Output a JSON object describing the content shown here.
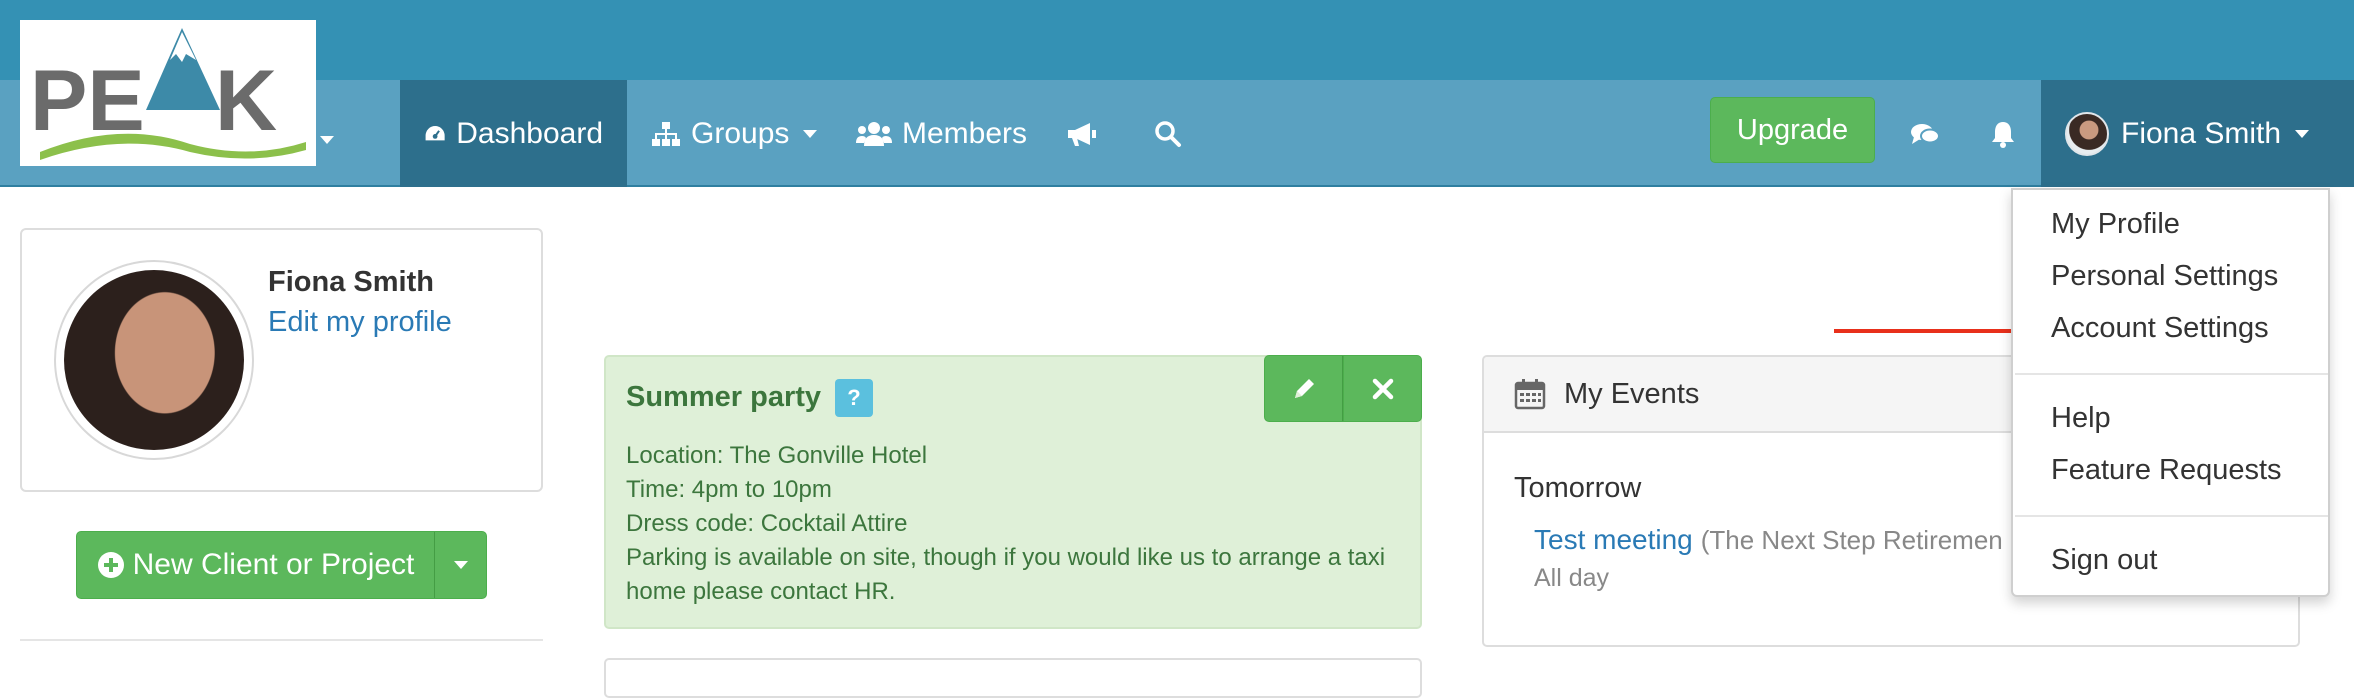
{
  "brand": {
    "logo_text": "PEAK"
  },
  "nav": {
    "dashboard": "Dashboard",
    "groups": "Groups",
    "members": "Members",
    "upgrade": "Upgrade",
    "user_name": "Fiona Smith"
  },
  "user_dropdown": {
    "items": [
      "My Profile",
      "Personal Settings",
      "Account Settings",
      "Help",
      "Feature Requests",
      "Sign out"
    ],
    "highlighted": "Account Settings"
  },
  "profile": {
    "name": "Fiona Smith",
    "edit_link": "Edit my profile"
  },
  "new_client_button": "New Client or Project",
  "announcement": {
    "title": "Summer party",
    "help_badge": "?",
    "lines": [
      "Location: The Gonville Hotel",
      "Time: 4pm to 10pm",
      "Dress code: Cocktail Attire",
      "Parking is available on site, though if you would like us to arrange a taxi home please contact HR."
    ]
  },
  "events": {
    "title": "My Events",
    "day": "Tomorrow",
    "event_title": "Test meeting",
    "event_meta": "(The Next Step Retiremen",
    "event_time": "All day"
  },
  "colors": {
    "topbar": "#3491b4",
    "navbar": "#5aa1c1",
    "nav_active": "#2d6f8c",
    "success": "#5cb85c",
    "announcement_bg": "#dff0d8",
    "annotation_arrow": "#e8301b"
  }
}
